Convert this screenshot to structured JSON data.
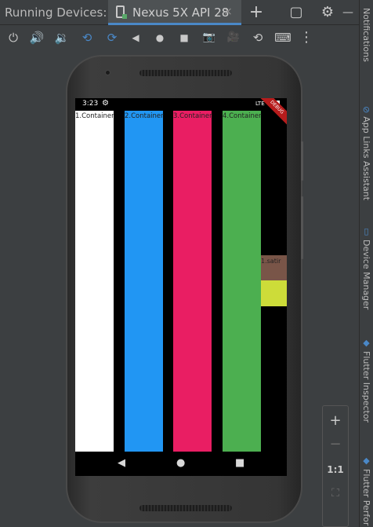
{
  "header": {
    "title": "Running Devices:",
    "tab_label": "Nexus 5X API 28",
    "tab_close": "×",
    "add": "+",
    "window": "▢",
    "settings": "⚙",
    "minimize": "—"
  },
  "toolbar": {
    "icons": [
      "power-icon",
      "volume-up-icon",
      "volume-down-icon",
      "rotate-left-icon",
      "rotate-right-icon",
      "back-icon",
      "home-icon",
      "overview-icon",
      "screenshot-icon",
      "screen-record-icon",
      "snapshot-icon",
      "keyboard-icon",
      "more-icon"
    ],
    "glyphs": [
      "⏻",
      "🔊",
      "🔉",
      "⟲",
      "⟳",
      "◀",
      "●",
      "■",
      "📷",
      "🎥",
      "⟲",
      "⌨",
      "⋮"
    ]
  },
  "right_stripe": {
    "labels": [
      "Notifications",
      "App Links Assistant",
      "Device Manager",
      "Flutter Inspector",
      "Flutter Perfor"
    ]
  },
  "phone_screen": {
    "status": {
      "time": "3:23",
      "settings_glyph": "⚙",
      "network": "LTE"
    },
    "debug_banner": "DEBUG",
    "columns": [
      {
        "label": "1.Container",
        "color": "#ffffff"
      },
      {
        "label": "2.Container",
        "color": "#2196f3"
      },
      {
        "label": "3.Container",
        "color": "#e91e63"
      },
      {
        "label": "4.Container",
        "color": "#4caf50"
      }
    ],
    "row_label": "1.satir",
    "row_colors": [
      "#795548",
      "#cddc39"
    ],
    "nav": {
      "back": "◀",
      "home": "●",
      "recent": "■"
    }
  },
  "zoom": {
    "in": "+",
    "out": "−",
    "actual": "1:1",
    "fit": "⛶"
  },
  "colors": {
    "accent": "#4a88c7",
    "background": "#3c3f41"
  }
}
